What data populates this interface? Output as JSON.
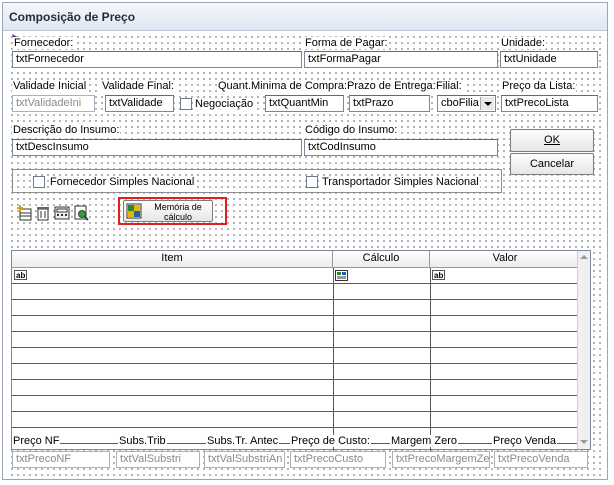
{
  "window": {
    "title": "Composição de Preço"
  },
  "row1": {
    "fornecedor_label": "Fornecedor:",
    "fornecedor_value": "txtFornecedor",
    "forma_pagar_label": "Forma de Pagar:",
    "forma_pagar_value": "txtFormaPagar",
    "unidade_label": "Unidade:",
    "unidade_value": "txtUnidade"
  },
  "row2": {
    "validade_inicial_label": "Validade Inicial",
    "validade_inicial_value": "txtValidadeIni",
    "validade_final_label": "Validade Final:",
    "validade_final_value": "txtValidade",
    "negociacao_label": "Negociação",
    "quant_minima_label": "Quant.Minima de Compra:",
    "quant_minima_value": "txtQuantMin",
    "prazo_entrega_label": "Prazo de Entrega:",
    "prazo_entrega_value": "txtPrazo",
    "filial_label": "Filial:",
    "filial_value": "cboFilia",
    "preco_lista_label": "Preço da Lista:",
    "preco_lista_value": "txtPrecoLista"
  },
  "row3": {
    "descricao_label": "Descrição do Insumo:",
    "descricao_value": "txtDescInsumo",
    "codigo_label": "Código do Insumo:",
    "codigo_value": "txtCodInsumo"
  },
  "buttons": {
    "ok": "OK",
    "cancelar": "Cancelar"
  },
  "checks": {
    "fornecedor_simples": "Fornecedor Simples Nacional",
    "transportador_simples": "Transportador Simples Nacional"
  },
  "toolbar": {
    "memoria_line1": "Memória de",
    "memoria_line2": "cálculo"
  },
  "grid": {
    "columns": [
      "Item",
      "Cálculo",
      "Valor"
    ]
  },
  "footer": {
    "preco_nf_label": "Preço NF",
    "preco_nf_value": "txtPrecoNF",
    "subs_trib_label": "Subs.Trib",
    "subs_trib_value": "txtValSubstri",
    "subs_tr_antec_label": "Subs.Tr. Antec",
    "subs_tr_antec_value": "txtValSubstriAn",
    "preco_custo_label": "Preço de Custo:",
    "preco_custo_value": "txtPrecoCusto",
    "margem_zero_label": "Margem Zero",
    "margem_zero_value": "txtPrecoMargemZe",
    "preco_venda_label": "Preço Venda",
    "preco_venda_value": "txtPrecoVenda"
  },
  "colors": {
    "highlight_box": "#e02020",
    "titlebar": "#dfe7f1"
  }
}
